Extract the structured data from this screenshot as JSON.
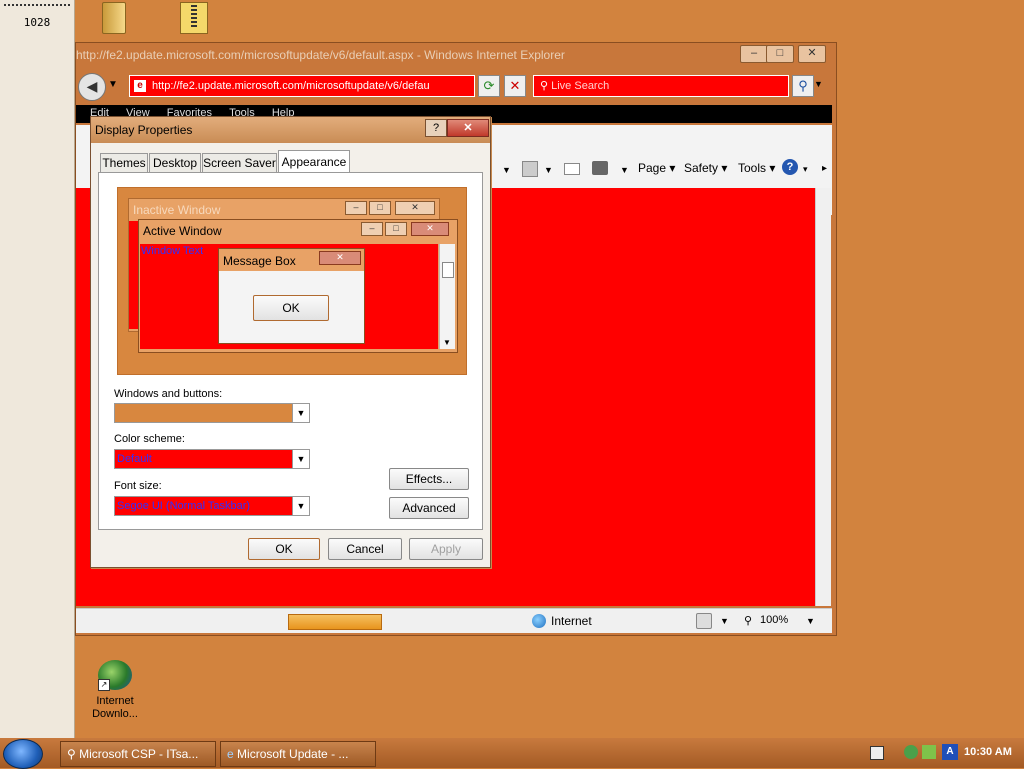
{
  "side_panel": {
    "number": "1028"
  },
  "ie": {
    "title": "http://fe2.update.microsoft.com/microsoftupdate/v6/default.aspx - Windows Internet Explorer",
    "address": "http://fe2.update.microsoft.com/microsoftupdate/v6/defau",
    "search_placeholder": "Live Search",
    "menu": [
      "Edit",
      "View",
      "Favorites",
      "Tools",
      "Help"
    ],
    "command_bar": {
      "page": "Page",
      "safety": "Safety",
      "tools": "Tools"
    },
    "status": {
      "zone": "Internet",
      "zoom": "100%"
    },
    "content_color": "#ff0000"
  },
  "dialog": {
    "title": "Display Properties",
    "help_label": "?",
    "tabs": [
      "Themes",
      "Desktop",
      "Screen Saver",
      "Appearance"
    ],
    "active_tab": "Appearance",
    "preview": {
      "inactive_title": "Inactive Window",
      "active_title": "Active Window",
      "window_text": "Window Text",
      "message_title": "Message Box",
      "message_ok": "OK"
    },
    "windows_buttons_label": "Windows and buttons:",
    "windows_buttons_value": "",
    "color_scheme_label": "Color scheme:",
    "color_scheme_value": "Default",
    "font_size_label": "Font size:",
    "font_size_value": "Segoe UI (Normal Taskbar)",
    "effects_label": "Effects...",
    "advanced_label": "Advanced",
    "ok_label": "OK",
    "cancel_label": "Cancel",
    "apply_label": "Apply"
  },
  "desktop": {
    "icon_label_line1": "Internet",
    "icon_label_line2": "Downlo..."
  },
  "taskbar": {
    "tasks": [
      "Microsoft CSP - ITsa...",
      "Microsoft Update - ..."
    ],
    "clock": "10:30 AM"
  },
  "colors": {
    "desktop": "#d2833e",
    "accent_red": "#ff0000",
    "window_frame": "#c8773b"
  }
}
